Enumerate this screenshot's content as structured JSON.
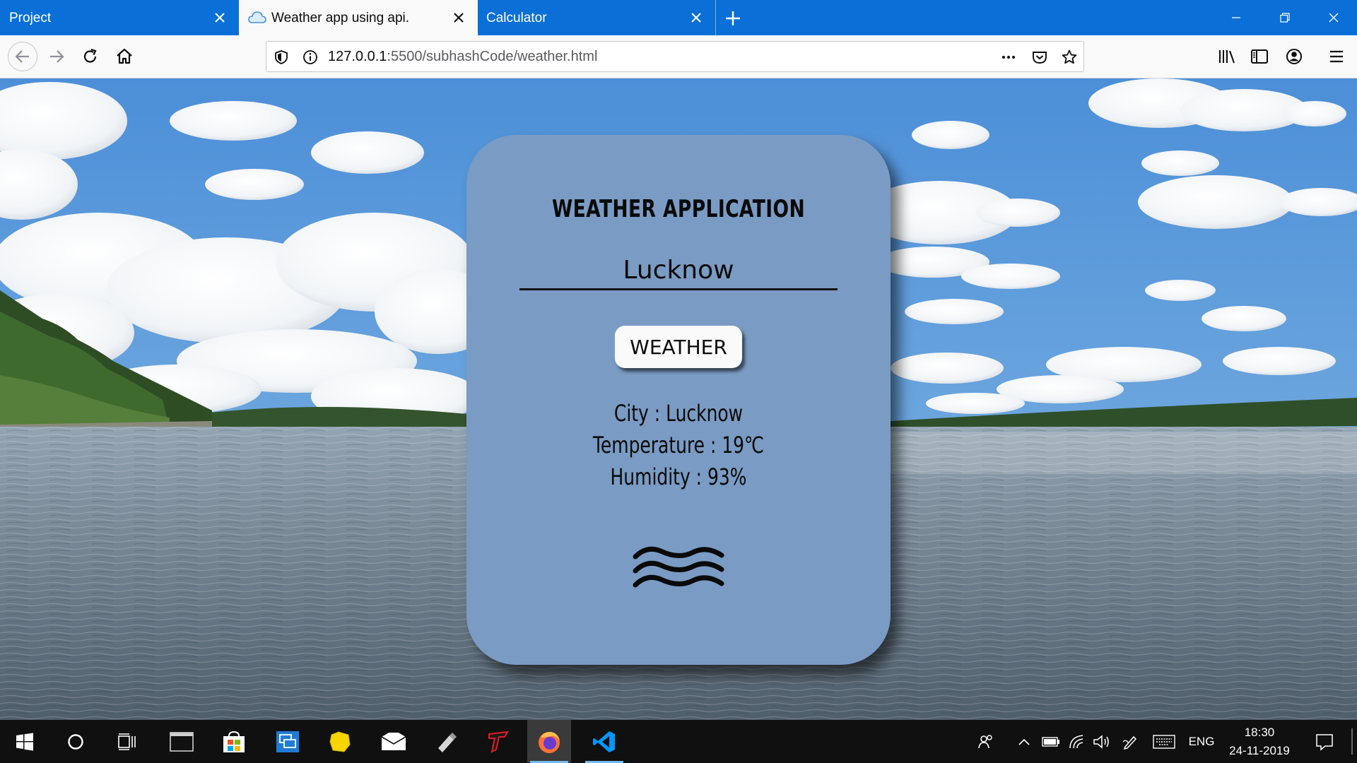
{
  "browser": {
    "tabs": [
      {
        "label": "Project",
        "active": false
      },
      {
        "label": "Weather app using api.",
        "active": true,
        "favicon": "cloud-icon"
      },
      {
        "label": "Calculator",
        "active": false
      }
    ],
    "url": {
      "host": "127.0.0.1",
      "path": ":5500/subhashCode/weather.html"
    },
    "accent_color": "#0a6fd6"
  },
  "app": {
    "title": "WEATHER APPLICATION",
    "city_input_value": "Lucknow",
    "button_label": "WEATHER",
    "results": {
      "city": "City : Lucknow",
      "temperature": "Temperature : 19℃",
      "humidity": "Humidity : 93%"
    },
    "weather_icon": "haze-wind-icon",
    "card_color": "#7a9bc3"
  },
  "taskbar": {
    "apps": [
      "start-icon",
      "search-icon",
      "task-view-icon",
      "terminal-icon",
      "store-icon",
      "remote-desktop-icon",
      "sticky-notes-icon",
      "mail-icon",
      "usb-drive-icon",
      "game-icon",
      "firefox-icon",
      "vscode-icon"
    ],
    "language": "ENG",
    "time": "18:30",
    "date": "24-11-2019"
  }
}
